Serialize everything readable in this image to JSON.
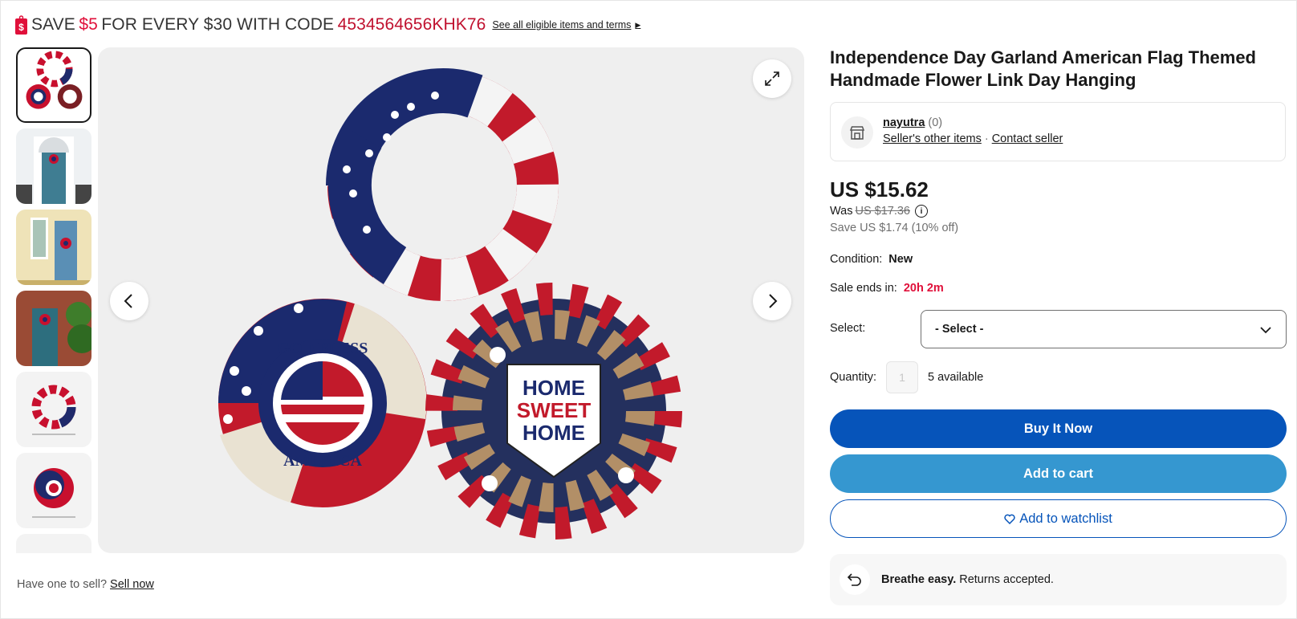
{
  "promo": {
    "save_word": "SAVE",
    "amount": "$5",
    "middle": "FOR EVERY $30 WITH CODE",
    "code": "4534564656KHK76",
    "terms_link": "See all eligible items and terms"
  },
  "gallery": {
    "thumbnail_count_visible": 6,
    "selected_index": 0
  },
  "sell_prompt": {
    "text": "Have one to sell?",
    "link": "Sell now"
  },
  "product": {
    "title": "Independence Day Garland American Flag Themed Handmade Flower Link Day Hanging",
    "seller_name": "nayutra",
    "seller_feedback": "(0)",
    "seller_other_items": "Seller's other items",
    "seller_dot": "·",
    "contact_seller": "Contact seller",
    "price": "US $15.62",
    "was_label": "Was",
    "was_price": "US $17.36",
    "info_glyph": "i",
    "save_text": "Save US $1.74 (10% off)",
    "condition_label": "Condition:",
    "condition_value": "New",
    "sale_ends_label": "Sale ends in:",
    "sale_ends_value": "20h 2m",
    "select_label": "Select:",
    "select_value": "- Select -",
    "quantity_label": "Quantity:",
    "quantity_value": "1",
    "available": "5 available"
  },
  "buttons": {
    "buy_now": "Buy It Now",
    "add_to_cart": "Add to cart",
    "add_to_watchlist": "Add to watchlist"
  },
  "returns": {
    "bold": "Breathe easy.",
    "text": "Returns accepted."
  },
  "colors": {
    "promo_red": "#e0103a",
    "buy_blue": "#0654ba",
    "cart_blue": "#3597d0"
  },
  "icons": [
    "price-tag-icon",
    "expand-icon",
    "chevron-left-icon",
    "chevron-right-icon",
    "store-icon",
    "info-icon",
    "chevron-down-icon",
    "heart-icon",
    "return-arrow-icon"
  ]
}
